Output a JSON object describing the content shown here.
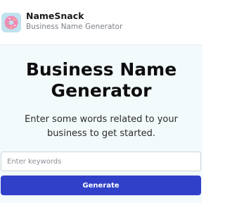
{
  "header": {
    "brand_name": "NameSnack",
    "brand_subtitle": "Business Name Generator",
    "logo_icon": "donut-logo-icon"
  },
  "main": {
    "title": "Business Name Generator",
    "subtitle": "Enter some words related to your business to get started.",
    "input_placeholder": "Enter keywords",
    "input_value": "",
    "generate_label": "Generate"
  },
  "colors": {
    "accent": "#3040c9",
    "hero_background": "#f3fafb",
    "logo_background": "#bfe3ee"
  }
}
